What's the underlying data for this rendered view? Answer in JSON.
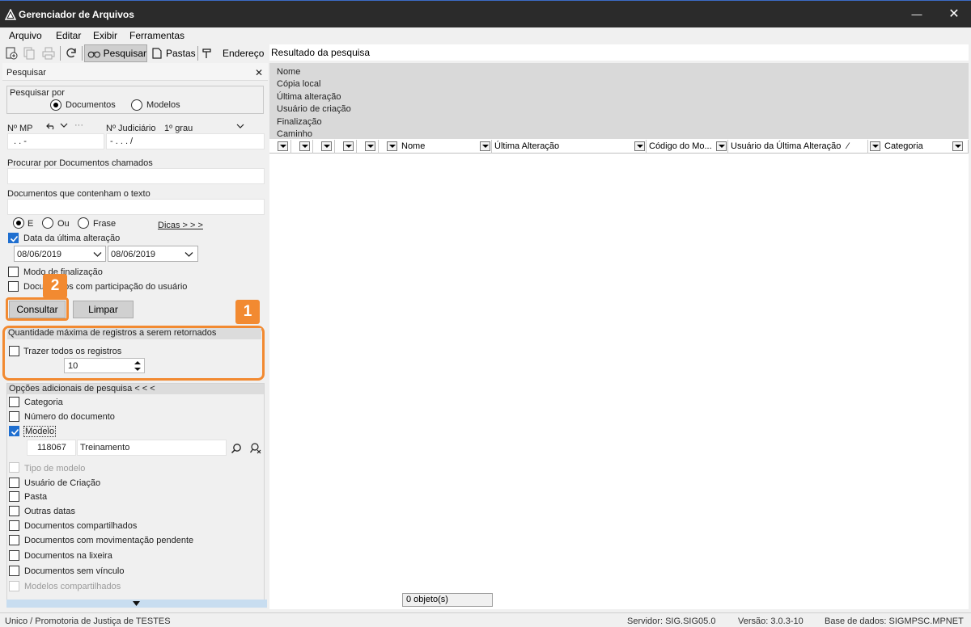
{
  "window": {
    "title": "Gerenciador de Arquivos",
    "minimize": "—",
    "close": "✕"
  },
  "menu": {
    "items": [
      "Arquivo",
      "Editar",
      "Exibir",
      "Ferramentas"
    ]
  },
  "toolbar": {
    "pesquisar": "Pesquisar",
    "pastas": "Pastas",
    "endereco": "Endereço"
  },
  "results": {
    "header": "Resultado da pesquisa",
    "info_lines": [
      "Nome",
      "Cópia local",
      "Última alteração",
      "Usuário de criação",
      "Finalização",
      "Caminho"
    ],
    "columns": [
      "Nome",
      "Última Alteração",
      "Código do Mo...",
      "Usuário da Última Alteração",
      "Categoria"
    ],
    "sort_indicator": "⁄",
    "status": "0 objeto(s)"
  },
  "search_panel": {
    "title": "Pesquisar",
    "close": "✕",
    "pesquisar_por": "Pesquisar por",
    "opt_documentos": "Documentos",
    "opt_modelos": "Modelos",
    "mp_label": "Nº MP",
    "mp_mask": ".     .          -",
    "judicial_label": "Nº Judiciário",
    "grau": "1º grau",
    "judicial_mask": "-     .     .     .       /",
    "more_dots": "···",
    "procurar_label": "Procurar por Documentos chamados",
    "contenham_label": "Documentos que contenham o texto",
    "opt_e": "E",
    "opt_ou": "Ou",
    "opt_frase": "Frase",
    "dicas": "Dicas > > >",
    "data_ultima": "Data da última alteração",
    "date_from": "08/06/2019",
    "date_to": "08/06/2019",
    "modo_finalizacao": "Modo de finalização",
    "participacao": "Documentos com participação do usuário",
    "consultar": "Consultar",
    "limpar": "Limpar",
    "quantidade_title": "Quantidade máxima de registros a serem retornados",
    "trazer_todos": "Trazer todos os registros",
    "max_registros": "10",
    "opcoes_title": "Opções adicionais de pesquisa < < <",
    "opt_categoria": "Categoria",
    "opt_numero": "Número do documento",
    "opt_modelo": "Modelo",
    "modelo_codigo": "118067",
    "modelo_nome": "Treinamento",
    "opt_tipo_modelo": "Tipo de modelo",
    "opt_usuario_criacao": "Usuário de Criação",
    "opt_pasta": "Pasta",
    "opt_outras_datas": "Outras datas",
    "opt_doc_compartilhados": "Documentos compartilhados",
    "opt_doc_mov_pendente": "Documentos com movimentação pendente",
    "opt_doc_lixeira": "Documentos na lixeira",
    "opt_doc_sem_vinculo": "Documentos sem vínculo",
    "opt_modelos_compartilhados": "Modelos compartilhados"
  },
  "annotations": {
    "badge1": "1",
    "badge2": "2",
    "highlight_color": "#f28a31"
  },
  "statusbar": {
    "org": "Unico / Promotoria de Justiça de TESTES",
    "servidor": "Servidor: SIG.SIG05.0",
    "versao": "Versão: 3.0.3-10",
    "base": "Base de dados: SIGMPSC.MPNET"
  }
}
